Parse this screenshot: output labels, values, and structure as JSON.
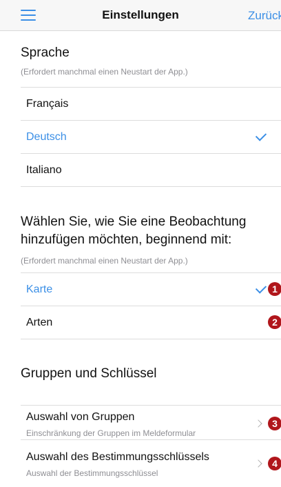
{
  "header": {
    "title": "Einstellungen",
    "back_label": "Zurück",
    "menu_icon": "hamburger-menu-icon",
    "accent": "#3b8fe6"
  },
  "language": {
    "title": "Sprache",
    "note": "(Erfordert manchmal einen Neustart der App.)",
    "options": [
      {
        "label": "Français",
        "selected": false
      },
      {
        "label": "Deutsch",
        "selected": true
      },
      {
        "label": "Italiano",
        "selected": false
      }
    ]
  },
  "observation": {
    "title_line1": "Wählen Sie, wie Sie eine Beobachtung",
    "title_line2": "hinzufügen möchten, beginnend mit:",
    "note": "(Erfordert manchmal einen Neustart der App.)",
    "options": [
      {
        "label": "Karte",
        "selected": true,
        "badge": "1"
      },
      {
        "label": "Arten",
        "selected": false,
        "badge": "2"
      }
    ]
  },
  "groups": {
    "title": "Gruppen und Schlüssel",
    "items": [
      {
        "label": "Auswahl von Gruppen",
        "sub": "Einschränkung der Gruppen im Meldeformular",
        "badge": "3"
      },
      {
        "label": "Auswahl des Bestimmungsschlüssels",
        "sub": "Auswahl der Bestimmungsschlüssel",
        "badge": "4"
      }
    ]
  },
  "badge_color": "#b0161b"
}
